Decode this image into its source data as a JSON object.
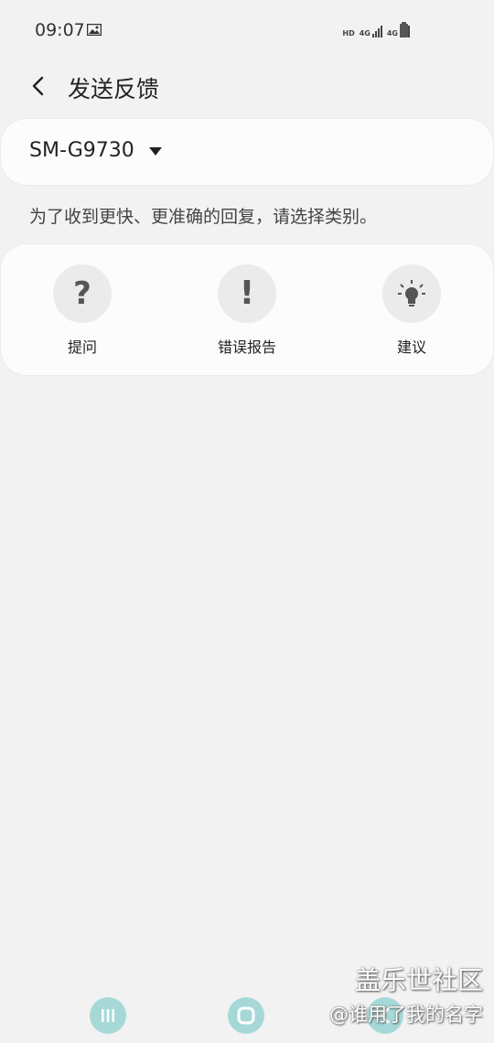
{
  "status_bar": {
    "time": "09:07",
    "hd": "HD",
    "sim1": "4G",
    "sim2": "4G"
  },
  "header": {
    "title": "发送反馈"
  },
  "device": {
    "label": "SM-G9730"
  },
  "hint": "为了收到更快、更准确的回复，请选择类别。",
  "categories": [
    {
      "label": "提问",
      "icon": "question-icon"
    },
    {
      "label": "错误报告",
      "icon": "exclamation-icon"
    },
    {
      "label": "建议",
      "icon": "lightbulb-icon"
    }
  ],
  "nav": {
    "buttons": [
      "recents-icon",
      "home-icon",
      "back-icon"
    ]
  },
  "watermark": {
    "main": "盖乐世社区",
    "sub": "@谁用了我的名字"
  },
  "colors": {
    "background": "#f2f2f2",
    "card": "#fcfcfc",
    "icon_circle": "#ebebeb",
    "nav_button": "#a6d8d8"
  }
}
